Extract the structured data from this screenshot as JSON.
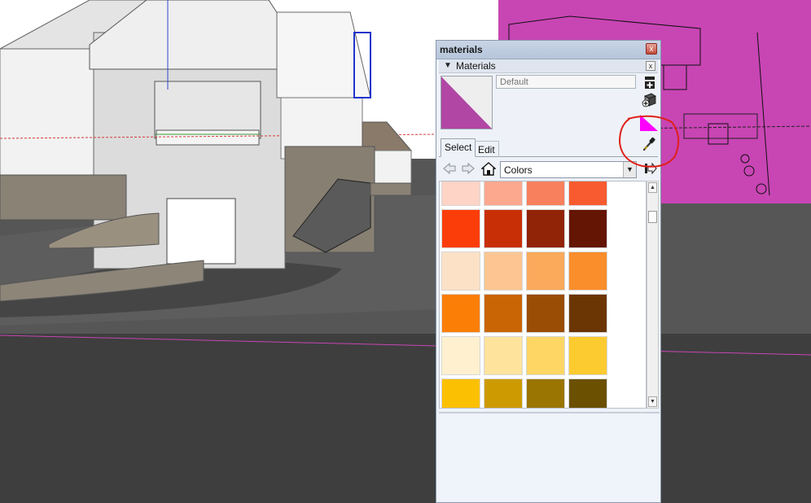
{
  "window": {
    "title": "materials",
    "close_label": "x"
  },
  "panel": {
    "header": "Materials",
    "close_label": "x"
  },
  "material": {
    "name_placeholder": "Default",
    "preview_color": "#b146a4"
  },
  "tabs": [
    {
      "label": "Select",
      "active": true
    },
    {
      "label": "Edit",
      "active": false
    }
  ],
  "library": {
    "selected": "Colors"
  },
  "swatches": [
    [
      "#fdd4c6",
      "#fca88f",
      "#f9805d",
      "#f75b2f"
    ],
    [
      "#fb3d09",
      "#c82f06",
      "#912306",
      "#641503"
    ],
    [
      "#fde1c7",
      "#fcc592",
      "#fba95b",
      "#f98e2b"
    ],
    [
      "#fb7e07",
      "#c96505",
      "#9a4d04",
      "#6b3603"
    ],
    [
      "#fff1cf",
      "#fee39d",
      "#fdd664",
      "#fccb30"
    ],
    [
      "#fcc003",
      "#cd9a02",
      "#9b7501",
      "#6b5001"
    ]
  ],
  "colors": {
    "sample_paint": "#ff00ff",
    "annotation": "#e0201a",
    "model_highlight": "#c845b4"
  }
}
